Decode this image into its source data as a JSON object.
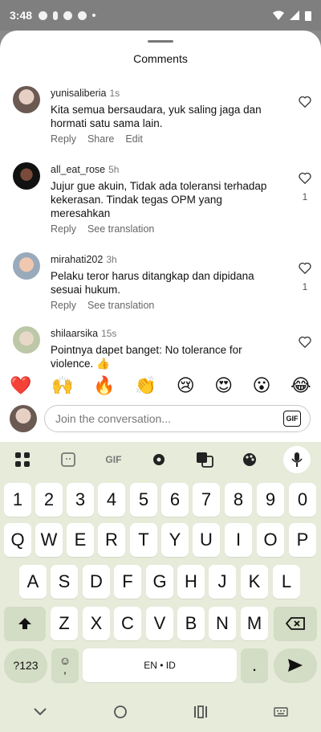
{
  "status_bar": {
    "time": "3:48"
  },
  "sheet": {
    "title": "Comments"
  },
  "comments": [
    {
      "user": "yunisaliberia",
      "time": "1s",
      "text": "Kita semua bersaudara, yuk saling jaga dan hormati satu sama lain.",
      "actions": [
        "Reply",
        "Share",
        "Edit"
      ],
      "likes": ""
    },
    {
      "user": "all_eat_rose",
      "time": "5h",
      "text": "Jujur gue akuin, Tidak ada toleransi terhadap kekerasan. Tindak tegas OPM yang meresahkan",
      "actions": [
        "Reply",
        "See translation"
      ],
      "likes": "1"
    },
    {
      "user": "mirahati202",
      "time": "3h",
      "text": "Pelaku teror harus ditangkap dan dipidana sesuai hukum.",
      "actions": [
        "Reply",
        "See translation"
      ],
      "likes": "1"
    },
    {
      "user": "shilaarsika",
      "time": "15s",
      "text": "Pointnya dapet banget: No tolerance for violence. 👍",
      "actions": [],
      "likes": ""
    }
  ],
  "emoji_bar": [
    "❤️",
    "🙌",
    "🔥",
    "👏",
    "😢",
    "😍",
    "😮",
    "😂"
  ],
  "compose": {
    "placeholder": "Join the conversation...",
    "gif_label": "GIF"
  },
  "keyboard": {
    "toolbar": {
      "gif": "GIF"
    },
    "row_numbers": [
      "1",
      "2",
      "3",
      "4",
      "5",
      "6",
      "7",
      "8",
      "9",
      "0"
    ],
    "row1": [
      "Q",
      "W",
      "E",
      "R",
      "T",
      "Y",
      "U",
      "I",
      "O",
      "P"
    ],
    "row2": [
      "A",
      "S",
      "D",
      "F",
      "G",
      "H",
      "J",
      "K",
      "L"
    ],
    "row3": [
      "Z",
      "X",
      "C",
      "V",
      "B",
      "N",
      "M"
    ],
    "symbols_label": "?123",
    "emoji_key": "☺",
    "comma": ",",
    "space_label": "EN • ID",
    "period": "."
  },
  "accent": "#d3dcc4"
}
